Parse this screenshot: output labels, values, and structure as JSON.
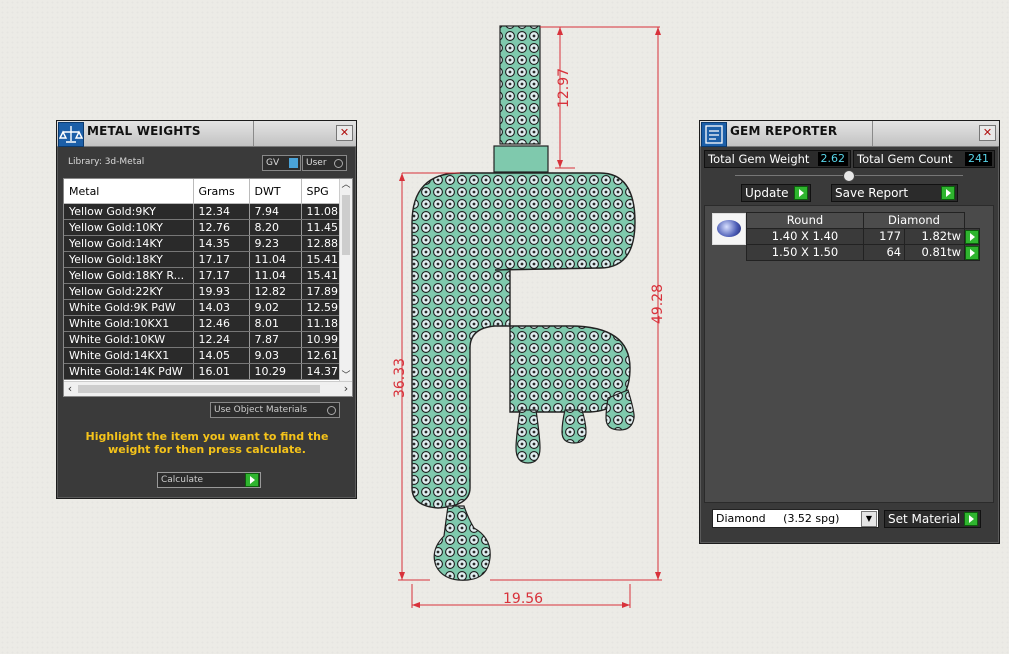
{
  "metal_weights": {
    "title": "METAL WEIGHTS",
    "library_label": "Library: 3d-Metal",
    "toggle_gv": "GV",
    "toggle_user": "User",
    "columns": [
      "Metal",
      "Grams",
      "DWT",
      "SPG"
    ],
    "rows": [
      {
        "metal": "Yellow Gold:9KY",
        "grams": "12.34",
        "dwt": "7.94",
        "spg": "11.08"
      },
      {
        "metal": "Yellow Gold:10KY",
        "grams": "12.76",
        "dwt": "8.20",
        "spg": "11.45"
      },
      {
        "metal": "Yellow Gold:14KY",
        "grams": "14.35",
        "dwt": "9.23",
        "spg": "12.88"
      },
      {
        "metal": "Yellow Gold:18KY",
        "grams": "17.17",
        "dwt": "11.04",
        "spg": "15.41"
      },
      {
        "metal": "Yellow Gold:18KY R...",
        "grams": "17.17",
        "dwt": "11.04",
        "spg": "15.41"
      },
      {
        "metal": "Yellow Gold:22KY",
        "grams": "19.93",
        "dwt": "12.82",
        "spg": "17.89"
      },
      {
        "metal": "White Gold:9K PdW",
        "grams": "14.03",
        "dwt": "9.02",
        "spg": "12.59"
      },
      {
        "metal": "White Gold:10KX1",
        "grams": "12.46",
        "dwt": "8.01",
        "spg": "11.18"
      },
      {
        "metal": "White Gold:10KW",
        "grams": "12.24",
        "dwt": "7.87",
        "spg": "10.99"
      },
      {
        "metal": "White Gold:14KX1",
        "grams": "14.05",
        "dwt": "9.03",
        "spg": "12.61"
      },
      {
        "metal": "White Gold:14K PdW",
        "grams": "16.01",
        "dwt": "10.29",
        "spg": "14.37"
      }
    ],
    "use_object_materials": "Use Object Materials",
    "hint": "Highlight the item you want to find the weight for then press calculate.",
    "calculate": "Calculate"
  },
  "gem_reporter": {
    "title": "GEM REPORTER",
    "total_weight_label": "Total Gem Weight",
    "total_weight_value": "2.62",
    "total_count_label": "Total Gem Count",
    "total_count_value": "241",
    "update": "Update",
    "save_report": "Save Report",
    "shape": "Round",
    "material": "Diamond",
    "rows": [
      {
        "size": "1.40 X 1.40",
        "count": "177",
        "weight": "1.82tw"
      },
      {
        "size": "1.50 X 1.50",
        "count": "64",
        "weight": "0.81tw"
      }
    ],
    "material_select": "Diamond     (3.52 spg)",
    "set_material": "Set Material"
  },
  "drawing": {
    "dim_bail_height": "12.97",
    "dim_total_height": "49.28",
    "dim_body_height": "36.33",
    "dim_width": "19.56"
  },
  "colors": {
    "accent_gold": "#f5c31a",
    "gem_fill": "#7fc9ad",
    "dimension_red": "#d8323b",
    "value_cyan": "#58d4e8"
  }
}
